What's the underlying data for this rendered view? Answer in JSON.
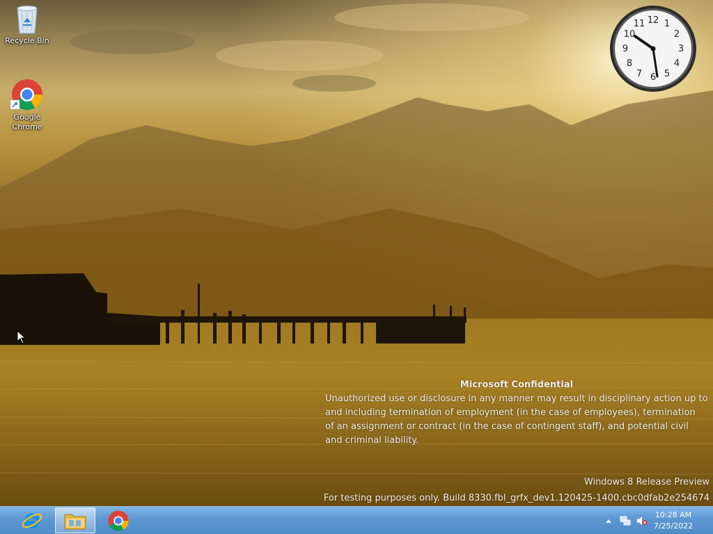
{
  "desktop": {
    "icons": [
      {
        "label": "Recycle Bin",
        "icon": "recycle-bin-icon"
      },
      {
        "label": "Google\nChrome",
        "icon": "chrome-icon"
      }
    ]
  },
  "gadget_clock": {
    "numbers": [
      "12",
      "1",
      "2",
      "3",
      "4",
      "5",
      "6",
      "7",
      "8",
      "9",
      "10",
      "11"
    ],
    "time_shown": "10:28"
  },
  "watermark": {
    "title": "Microsoft Confidential",
    "lines": [
      "Unauthorized use or disclosure in any manner may result in disciplinary action up to",
      "and including termination of employment (in the case of employees), termination",
      "of an assignment or contract (in the case of contingent staff), and potential civil",
      "and criminal liability."
    ],
    "os_name": "Windows 8 Release Preview",
    "build": "For testing purposes only. Build 8330.fbl_grfx_dev1.120425-1400.cbc0dfab2e254674"
  },
  "taskbar": {
    "pinned": [
      {
        "name": "internet-explorer-icon",
        "active": false
      },
      {
        "name": "file-explorer-icon",
        "active": true
      },
      {
        "name": "chrome-icon",
        "active": false
      }
    ],
    "tray": {
      "icons": [
        "show-hidden-icons-chevron",
        "network-icon",
        "volume-muted-icon"
      ],
      "time": "10:28 AM",
      "date": "7/25/2022"
    }
  },
  "colors": {
    "taskbar": "#5c97d2",
    "wallpaper_sky": "#c9ae6a",
    "wallpaper_water": "#8c6612"
  }
}
